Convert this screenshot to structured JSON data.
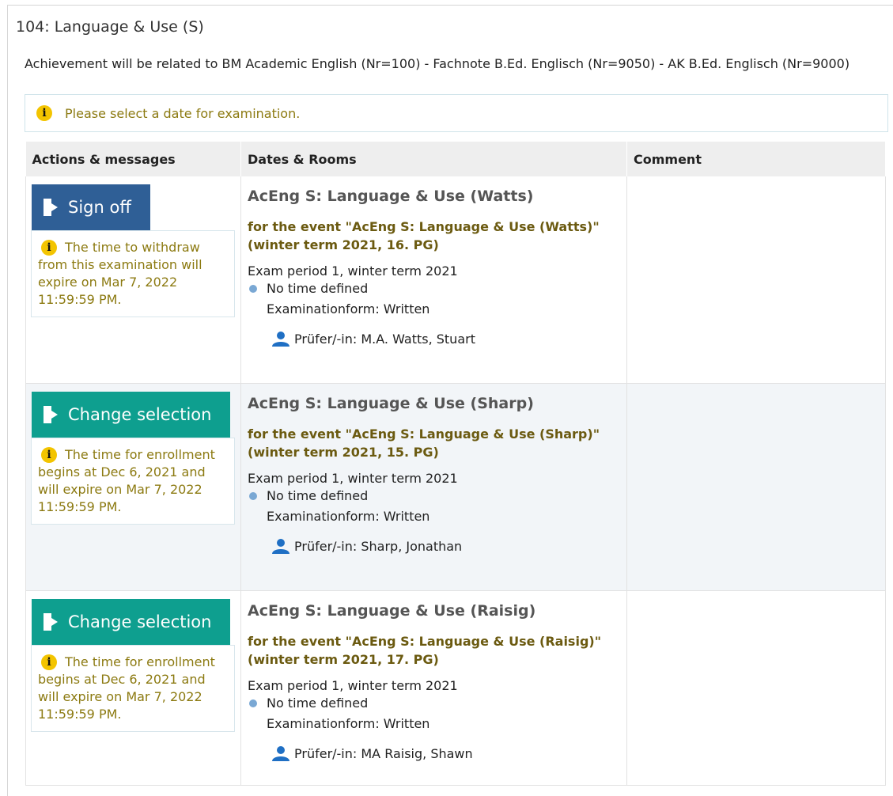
{
  "title": "104: Language & Use (S)",
  "relation_text": "Achievement will be related to BM Academic English (Nr=100) - Fachnote B.Ed. Englisch (Nr=9050) - AK B.Ed. Englisch (Nr=9000)",
  "notice": "Please select a date for examination.",
  "table": {
    "headers": [
      "Actions & messages",
      "Dates & Rooms",
      "Comment"
    ],
    "rows": [
      {
        "action_label": "Sign off",
        "message": "The time to withdraw from this examination will expire on Mar 7, 2022 11:59:59 PM.",
        "event_title": "AcEng S: Language & Use (Watts)",
        "event_sub": "for the event \"AcEng S: Language & Use (Watts)\" (winter term 2021, 16. PG)",
        "exam_period": "Exam period 1, winter term 2021",
        "time": "No time defined",
        "exam_form": "Examinationform: Written",
        "examiner": "Prüfer/-in: M.A. Watts, Stuart",
        "comment": ""
      },
      {
        "action_label": "Change selection",
        "message": "The time for enrollment begins at Dec 6, 2021 and will expire on Mar 7, 2022 11:59:59 PM.",
        "event_title": "AcEng S: Language & Use (Sharp)",
        "event_sub": "for the event \"AcEng S: Language & Use (Sharp)\" (winter term 2021, 15. PG)",
        "exam_period": "Exam period 1, winter term 2021",
        "time": "No time defined",
        "exam_form": "Examinationform: Written",
        "examiner": "Prüfer/-in: Sharp, Jonathan",
        "comment": ""
      },
      {
        "action_label": "Change selection",
        "message": "The time for enrollment begins at Dec 6, 2021 and will expire on Mar 7, 2022 11:59:59 PM.",
        "event_title": "AcEng S: Language & Use (Raisig)",
        "event_sub": "for the event \"AcEng S: Language & Use (Raisig)\" (winter term 2021, 17. PG)",
        "exam_period": "Exam period 1, winter term 2021",
        "time": "No time defined",
        "exam_form": "Examinationform: Written",
        "examiner": "Prüfer/-in: MA Raisig, Shawn",
        "comment": ""
      }
    ]
  },
  "icons": {
    "info": "info-icon",
    "door": "door-exit-icon",
    "person": "person-icon",
    "bullet": "bullet-dot"
  },
  "colors": {
    "sign_off_button": "#2f5f96",
    "change_selection_button": "#0e9f8f",
    "info_text": "#8c7a11",
    "info_icon": "#f3c400"
  }
}
